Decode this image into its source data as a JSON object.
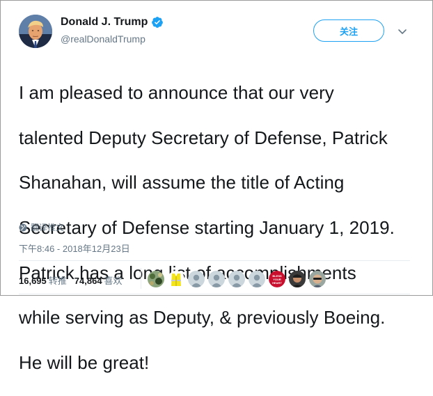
{
  "tweet": {
    "display_name": "Donald J. Trump",
    "handle": "@realDonaldTrump",
    "follow_label": "关注",
    "text_lines": [
      "I am pleased to announce that our very",
      "talented Deputy Secretary of Defense, Patrick",
      "Shanahan, will assume the title of Acting",
      "Secretary of Defense starting January 1, 2019.",
      "Patrick has a long list of accomplishments",
      "while serving as Deputy, & previously Boeing.",
      "He will be great!"
    ],
    "translate_label": "翻译推文",
    "timestamp": "下午8:46 - 2018年12月23日"
  },
  "stats": {
    "retweets": "16,695",
    "retweets_label": "转推",
    "likes": "74,864",
    "likes_label": "喜欢"
  },
  "likers": [
    {
      "icon": "avatar-camo-icon"
    },
    {
      "icon": "avatar-yellow-vest-icon"
    },
    {
      "icon": "default-avatar-icon"
    },
    {
      "icon": "default-avatar-icon"
    },
    {
      "icon": "default-avatar-icon"
    },
    {
      "icon": "default-avatar-icon"
    },
    {
      "icon": "avatar-bless-your-heart-icon",
      "badge": "BLESS YOUR HEART"
    },
    {
      "icon": "avatar-person-icon"
    },
    {
      "icon": "avatar-sunglasses-icon"
    }
  ],
  "colors": {
    "accent": "#1da1f2",
    "verified": "#1da1f2",
    "secondary_text": "#657786",
    "primary_text": "#14171a",
    "divider": "#e6ecf0"
  }
}
